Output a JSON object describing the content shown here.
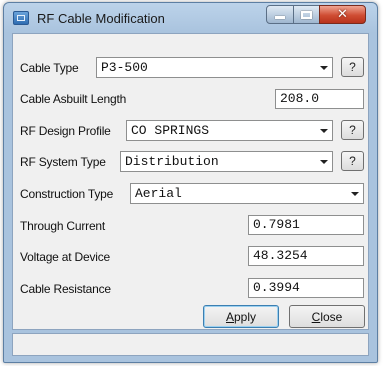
{
  "window": {
    "title": "RF Cable Modification",
    "controls": {
      "minimize": "minimize",
      "maximize": "maximize",
      "close": "✕"
    }
  },
  "form": {
    "cable_type": {
      "label": "Cable Type",
      "value": "P3-500",
      "help": "?"
    },
    "asbuilt_length": {
      "label": "Cable Asbuilt Length",
      "value": "208.0"
    },
    "design_profile": {
      "label": "RF Design Profile",
      "value": "CO SPRINGS",
      "help": "?"
    },
    "system_type": {
      "label": "RF System Type",
      "value": "Distribution",
      "help": "?"
    },
    "construction_type": {
      "label": "Construction Type",
      "value": "Aerial"
    },
    "through_current": {
      "label": "Through Current",
      "value": "0.7981"
    },
    "voltage_at_device": {
      "label": "Voltage at Device",
      "value": "48.3254"
    },
    "cable_resistance": {
      "label": "Cable Resistance",
      "value": "0.3994"
    }
  },
  "buttons": {
    "apply": {
      "mnemonic": "A",
      "rest": "pply"
    },
    "close": {
      "mnemonic": "C",
      "rest": "lose"
    }
  }
}
